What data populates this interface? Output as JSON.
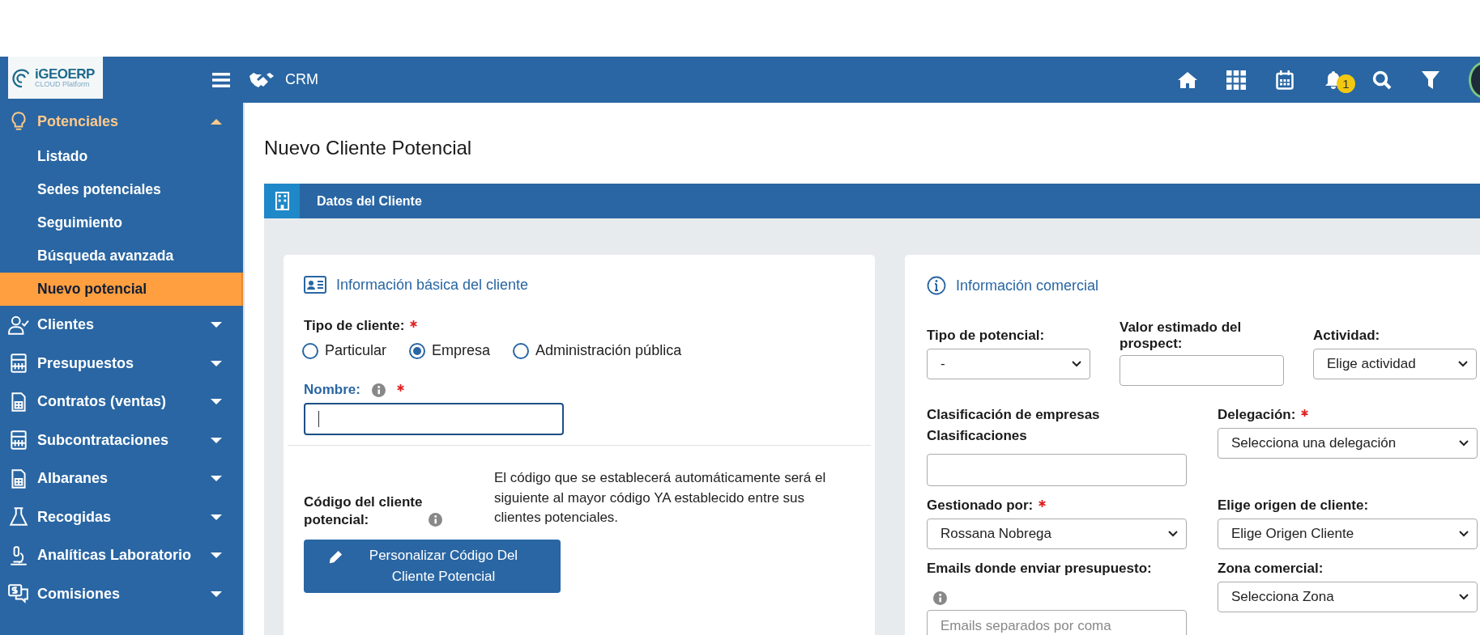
{
  "logo": {
    "name": "iGEOERP",
    "tagline": "CLOUD Platform"
  },
  "header": {
    "module": "CRM",
    "notifications": "1"
  },
  "sidebar": {
    "items": [
      {
        "label": "Potenciales",
        "expanded": true,
        "children": [
          {
            "label": "Listado",
            "selected": false
          },
          {
            "label": "Sedes potenciales",
            "selected": false
          },
          {
            "label": "Seguimiento",
            "selected": false
          },
          {
            "label": "Búsqueda avanzada",
            "selected": false
          },
          {
            "label": "Nuevo potencial",
            "selected": true
          }
        ]
      },
      {
        "label": "Clientes",
        "expanded": false
      },
      {
        "label": "Presupuestos",
        "expanded": false
      },
      {
        "label": "Contratos (ventas)",
        "expanded": false
      },
      {
        "label": "Subcontrataciones",
        "expanded": false
      },
      {
        "label": "Albaranes",
        "expanded": false
      },
      {
        "label": "Recogidas",
        "expanded": false
      },
      {
        "label": "Analíticas Laboratorio",
        "expanded": false
      },
      {
        "label": "Comisiones",
        "expanded": false
      }
    ]
  },
  "page": {
    "title": "Nuevo Cliente Potencial",
    "section": "Datos del Cliente"
  },
  "basic": {
    "title": "Información básica del cliente",
    "client_type": {
      "label": "Tipo de cliente:",
      "required": true,
      "options": [
        {
          "label": "Particular",
          "selected": false
        },
        {
          "label": "Empresa",
          "selected": true
        },
        {
          "label": "Administración pública",
          "selected": false
        }
      ]
    },
    "name": {
      "label": "Nombre:",
      "info": true,
      "required": true,
      "focused": true
    },
    "code": {
      "label": "Código del cliente potencial:",
      "info": true,
      "description": "El código que se establecerá automáticamente será el siguiente al mayor código YA establecido entre sus clientes potenciales.",
      "button": "Personalizar Código Del Cliente Potencial"
    }
  },
  "commercial": {
    "title": "Información comercial",
    "top_row": [
      {
        "kind": "select",
        "label": "Tipo de potencial:",
        "required": false,
        "info": false,
        "value": "-"
      },
      {
        "kind": "input",
        "label": "Valor estimado del prospect:",
        "required": false,
        "info": false
      },
      {
        "kind": "select",
        "label": "Actividad:",
        "required": false,
        "info": false,
        "value": "Elige actividad"
      }
    ],
    "grid": [
      {
        "kind": "input",
        "label": "Clasificación de empresas",
        "sublabel": "Clasificaciones",
        "required": false,
        "info": false
      },
      {
        "kind": "select",
        "label": "Delegación:",
        "required": true,
        "info": false,
        "value": "Selecciona una delegación"
      },
      {
        "kind": "select",
        "label": "Gestionado por:",
        "required": true,
        "info": false,
        "value": "Rossana Nobrega"
      },
      {
        "kind": "select",
        "label": "Elige origen de cliente:",
        "required": false,
        "info": false,
        "value": "Elige Origen Cliente"
      },
      {
        "kind": "input",
        "label": "Emails donde enviar presupuesto:",
        "required": false,
        "info": true,
        "placeholder": "Emails separados por coma"
      },
      {
        "kind": "select",
        "label": "Zona comercial:",
        "required": false,
        "info": false,
        "value": "Selecciona Zona"
      }
    ]
  }
}
